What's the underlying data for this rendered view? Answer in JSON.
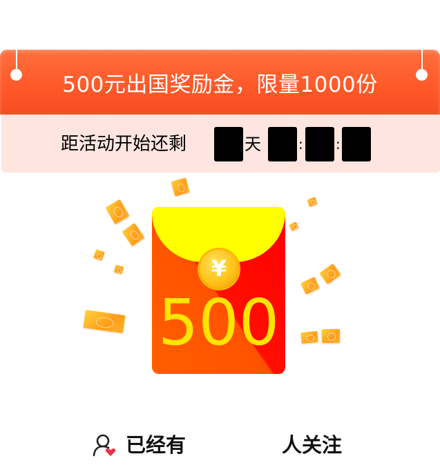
{
  "banner": {
    "title": "500元出国奖励金，限量1000份"
  },
  "countdown": {
    "label": "距活动开始还剩",
    "days": "",
    "day_unit": "天",
    "hours": "",
    "minutes": "",
    "seconds": "",
    "separator": ":"
  },
  "red_packet": {
    "currency_symbol": "¥",
    "amount": "500"
  },
  "follow": {
    "prefix": "已经有",
    "count": "",
    "suffix": "人关注"
  },
  "colors": {
    "banner": "#ff5a2a",
    "countdown_bg": "#fee5df",
    "packet_red": "#ff0000",
    "packet_flap": "#ffff00",
    "amount_text": "#ffe400"
  },
  "icons": [
    "user-heart-icon",
    "coin-icon"
  ]
}
